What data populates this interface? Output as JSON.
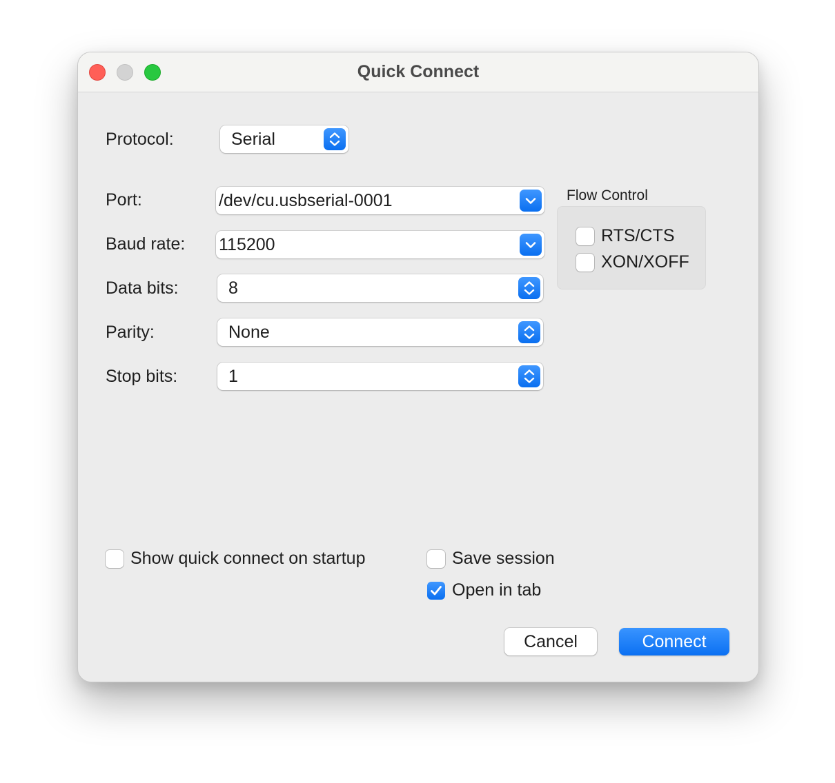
{
  "window": {
    "title": "Quick Connect"
  },
  "protocol": {
    "label": "Protocol:",
    "value": "Serial"
  },
  "port": {
    "label": "Port:",
    "value": "/dev/cu.usbserial-0001"
  },
  "baud_rate": {
    "label": "Baud rate:",
    "value": "115200"
  },
  "data_bits": {
    "label": "Data bits:",
    "value": "8"
  },
  "parity": {
    "label": "Parity:",
    "value": "None"
  },
  "stop_bits": {
    "label": "Stop bits:",
    "value": "1"
  },
  "flow_control": {
    "title": "Flow Control",
    "rts_cts": {
      "label": "RTS/CTS",
      "checked": false
    },
    "xon_xoff": {
      "label": "XON/XOFF",
      "checked": false
    }
  },
  "options": {
    "show_on_startup": {
      "label": "Show quick connect on startup",
      "checked": false
    },
    "save_session": {
      "label": "Save session",
      "checked": false
    },
    "open_in_tab": {
      "label": "Open in tab",
      "checked": true
    }
  },
  "buttons": {
    "cancel": "Cancel",
    "connect": "Connect"
  },
  "colors": {
    "accent": "#0a6ff0",
    "close": "#ff5f57",
    "minimize_inactive": "#d3d3d3",
    "maximize": "#28c840",
    "window_bg": "#ececec"
  }
}
